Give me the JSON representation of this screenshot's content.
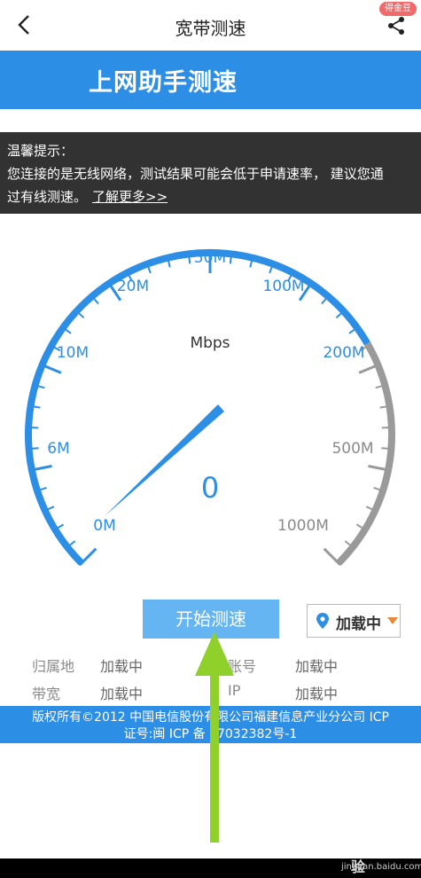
{
  "header": {
    "title": "宽带测速",
    "badge": "得金豆"
  },
  "banner": {
    "title": "上网助手测速"
  },
  "tip": {
    "title": "温馨提示：",
    "line1": "您连接的是无线网络，测试结果可能会低于申请速率， 建议您通",
    "line2": "过有线测速。",
    "link": "了解更多>>"
  },
  "gauge": {
    "unit": "Mbps",
    "value": "0",
    "needle_level_mbps": 0,
    "labels": {
      "l0": "0M",
      "l6": "6M",
      "l10": "10M",
      "l20": "20M",
      "l50": "50M",
      "l100": "100M",
      "l200": "200M",
      "l500": "500M",
      "l1000": "1000M"
    },
    "colors": {
      "active": "#2d8ee6",
      "inactive": "#9a9a9a"
    }
  },
  "controls": {
    "start_label": "开始测速",
    "location_value": "加载中"
  },
  "info": {
    "attribution_label": "归属地",
    "attribution_value": "加载中",
    "account_label": "账号",
    "account_value": "加载中",
    "bandwidth_label": "带宽",
    "bandwidth_value": "加载中",
    "ip_label": "IP",
    "ip_value": "加载中"
  },
  "footer": {
    "line1": "版权所有©2012 中国电信股份有限公司福建信息产业分公司 ICP",
    "line2": "证号:闽 ICP 备 07032382号-1"
  },
  "watermark": {
    "text": "Bai du 经验",
    "url": "jingyan.baidu.com"
  }
}
